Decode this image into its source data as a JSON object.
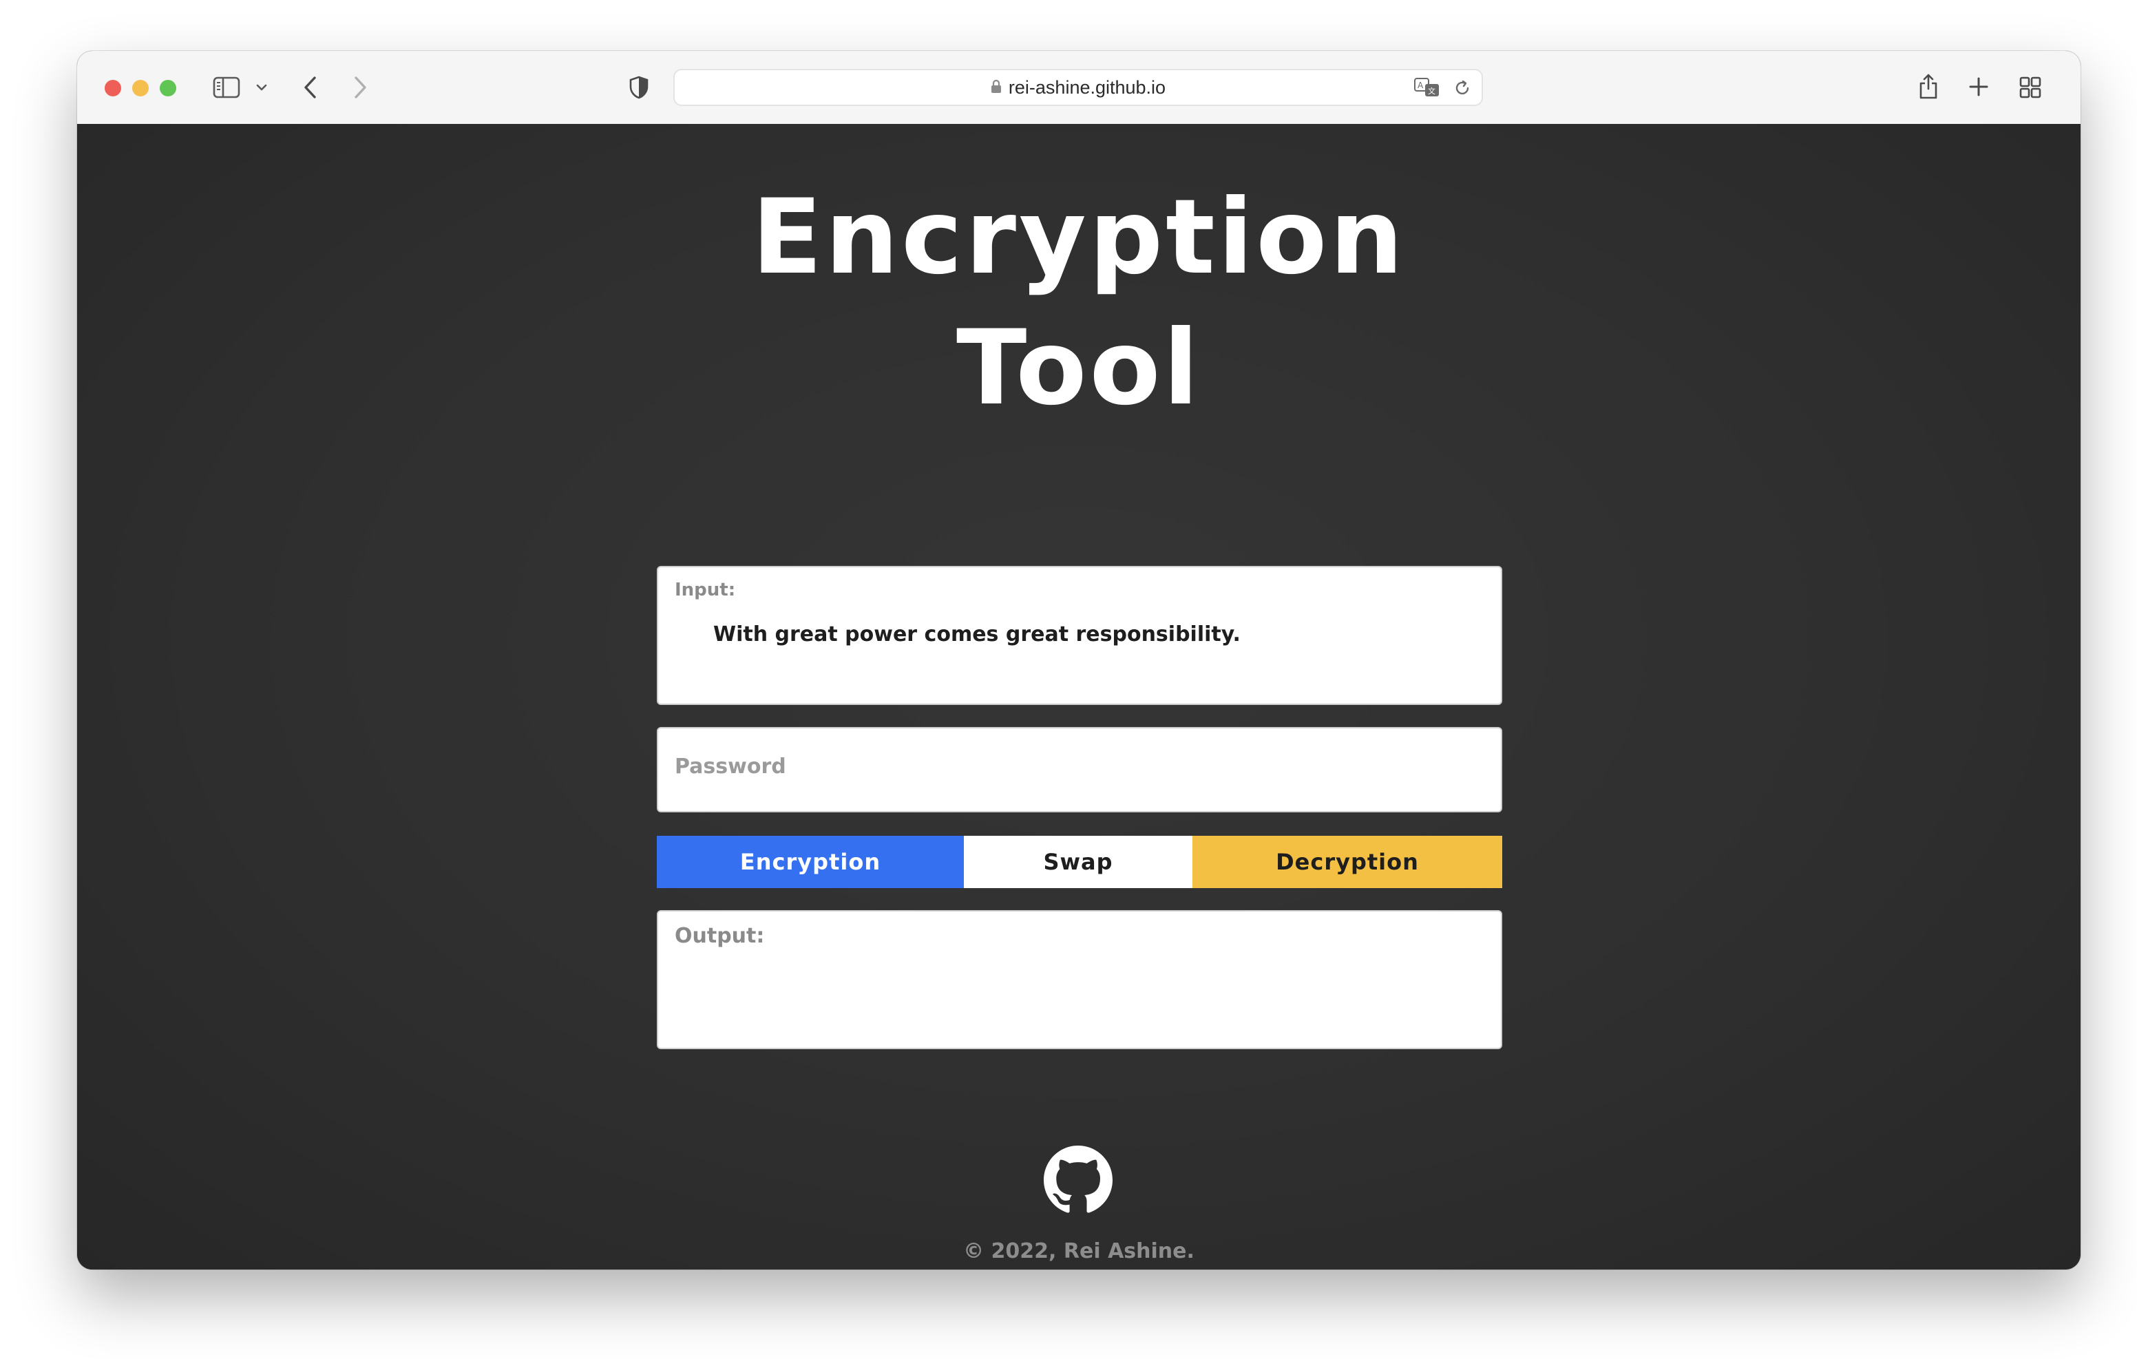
{
  "browser": {
    "url": "rei-ashine.github.io"
  },
  "page": {
    "title_line1": "Encryption",
    "title_line2": "Tool",
    "input_label": "Input:",
    "input_value": "With great power comes great responsibility.",
    "password_placeholder": "Password",
    "output_label": "Output:",
    "output_value": ""
  },
  "buttons": {
    "encryption": "Encryption",
    "swap": "Swap",
    "decryption": "Decryption"
  },
  "footer": {
    "copyright": "© 2022, Rei Ashine."
  },
  "colors": {
    "encryption": "#3570f0",
    "swap": "#ffffff",
    "decryption": "#f4c043",
    "page_bg": "#2f2f2f"
  },
  "icons": [
    "sidebar-icon",
    "chevron-down-icon",
    "back-icon",
    "forward-icon",
    "shield-icon",
    "lock-icon",
    "translate-icon",
    "reload-icon",
    "share-icon",
    "new-tab-icon",
    "tab-overview-icon",
    "github-icon"
  ]
}
